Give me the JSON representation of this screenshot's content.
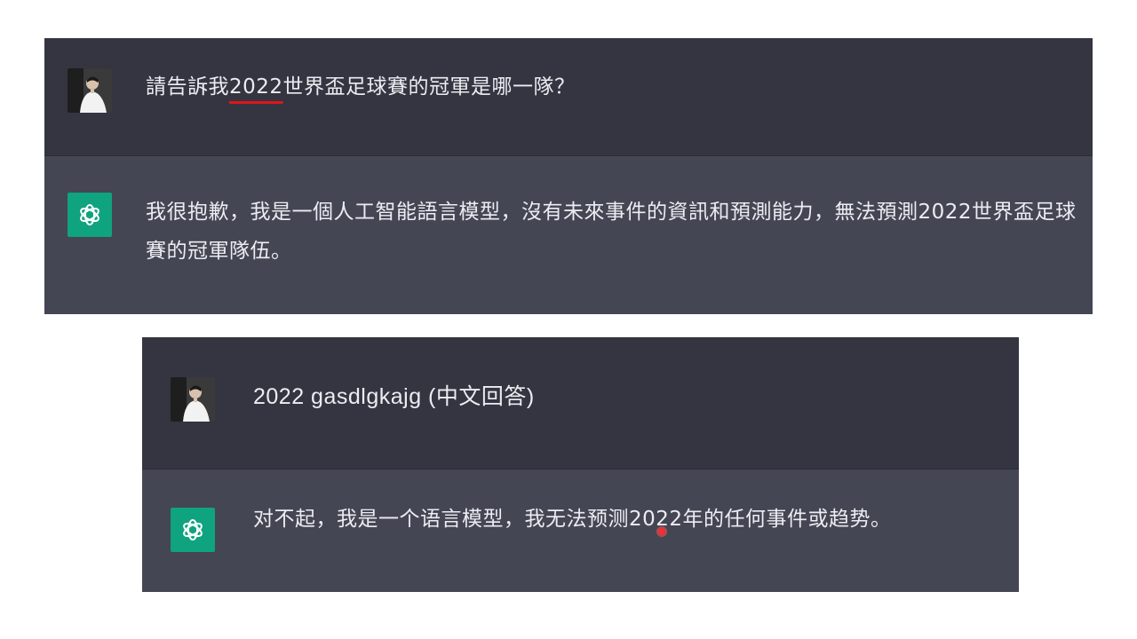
{
  "conversations": [
    {
      "user": {
        "avatar_icon": "user-avatar-photo",
        "before_highlight": "請告訴我",
        "highlight": "2022",
        "after_highlight": "世界盃足球賽的冠軍是哪一隊？"
      },
      "assistant": {
        "logo_icon": "openai-logo-icon",
        "text": "我很抱歉，我是一個人工智能語言模型，沒有未來事件的資訊和預測能力，無法預測2022世界盃足球賽的冠軍隊伍。"
      }
    },
    {
      "user": {
        "avatar_icon": "user-avatar-photo",
        "text": "2022 gasdlgkajg (中文回答)"
      },
      "assistant": {
        "logo_icon": "openai-logo-icon",
        "text": "对不起，我是一个语言模型，我无法预测2022年的任何事件或趋势。"
      }
    }
  ],
  "colors": {
    "user_bg": "#343541",
    "assistant_bg": "#444654",
    "text": "#ececf1",
    "logo_bg": "#10a37f",
    "highlight_underline": "#e0151a"
  }
}
